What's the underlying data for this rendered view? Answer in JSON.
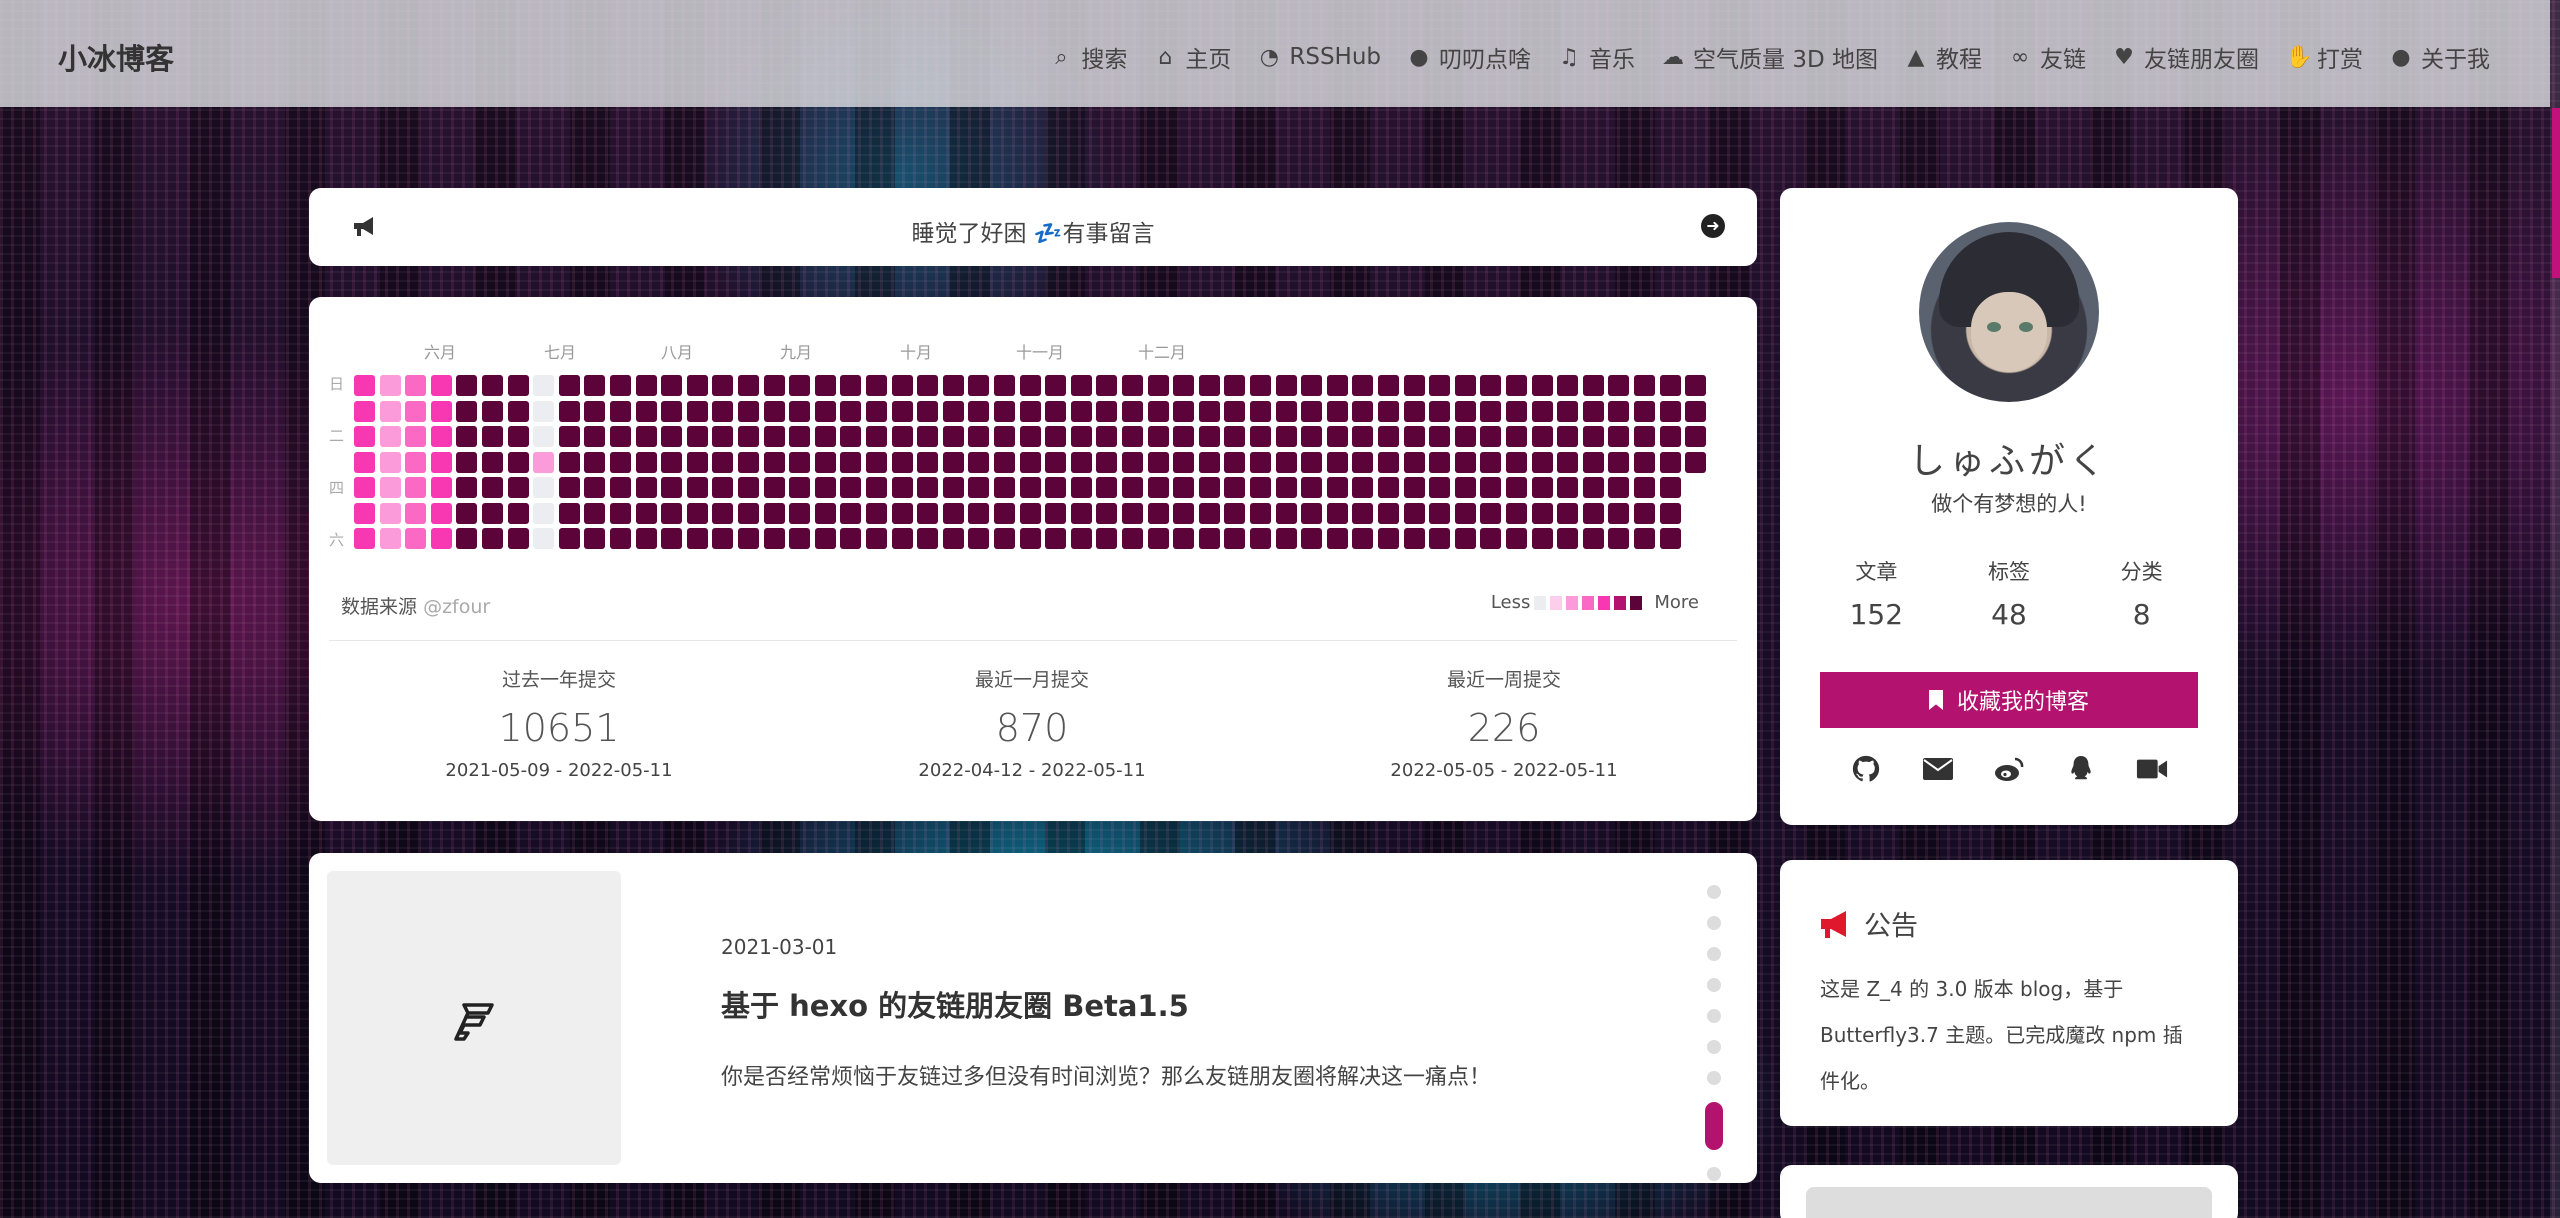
{
  "nav": {
    "brand": "小冰博客",
    "items": [
      {
        "icon": "search-icon",
        "glyph": "⌕",
        "label": "搜索"
      },
      {
        "icon": "home-icon",
        "glyph": "⌂",
        "label": "主页"
      },
      {
        "icon": "rss-icon",
        "glyph": "◔",
        "label": "RSSHub"
      },
      {
        "icon": "comment-icon",
        "glyph": "●",
        "label": "叨叨点啥"
      },
      {
        "icon": "music-icon",
        "glyph": "♫",
        "label": "音乐"
      },
      {
        "icon": "cloud-icon",
        "glyph": "☁",
        "label": "空气质量 3D 地图"
      },
      {
        "icon": "graduation-cap-icon",
        "glyph": "▲",
        "label": "教程"
      },
      {
        "icon": "link-icon",
        "glyph": "∞",
        "label": "友链"
      },
      {
        "icon": "heart-icon",
        "glyph": "♥",
        "label": "友链朋友圈"
      },
      {
        "icon": "thumbs-up-icon",
        "glyph": "✋",
        "label": "打赏"
      },
      {
        "icon": "lightbulb-icon",
        "glyph": "●",
        "label": "关于我"
      }
    ]
  },
  "notice": {
    "text": "睡觉了好困 💤有事留言"
  },
  "heatmap": {
    "months": [
      "六月",
      "七月",
      "八月",
      "九月",
      "十月",
      "十一月",
      "十二月"
    ],
    "weekdays": [
      "日",
      "二",
      "四",
      "六"
    ],
    "source_label": "数据来源",
    "source_user": "@zfour",
    "legend_less": "Less",
    "legend_more": "More",
    "colors": [
      "#ebedf0",
      "#fdcdec",
      "#fc9bd9",
      "#fa6ac5",
      "#f838b2",
      "#b3126e",
      "#5c0439"
    ],
    "stats": [
      {
        "label": "过去一年提交",
        "value": "10651",
        "range": "2021-05-09 - 2022-05-11"
      },
      {
        "label": "最近一月提交",
        "value": "870",
        "range": "2022-04-12 - 2022-05-11"
      },
      {
        "label": "最近一周提交",
        "value": "226",
        "range": "2022-05-05 - 2022-05-11"
      }
    ]
  },
  "post": {
    "date": "2021-03-01",
    "title": "基于 hexo 的友链朋友圈 Beta1.5",
    "description": "你是否经常烦恼于友链过多但没有时间浏览？那么友链朋友圈将解决这一痛点！"
  },
  "author": {
    "name": "しゅふがく",
    "description": "做个有梦想的人!",
    "counts": [
      {
        "label": "文章",
        "value": "152"
      },
      {
        "label": "标签",
        "value": "48"
      },
      {
        "label": "分类",
        "value": "8"
      }
    ],
    "button_label": "收藏我的博客",
    "socials": [
      "github-icon",
      "mail-icon",
      "weibo-icon",
      "qq-icon",
      "video-icon"
    ],
    "accent": "#b3126e"
  },
  "announcement": {
    "title": "公告",
    "body": "这是 Z_4 的 3.0 版本 blog，基于 Butterfly3.7 主题。已完成魔改 npm 插件化。",
    "icon_color": "#e0182e"
  }
}
